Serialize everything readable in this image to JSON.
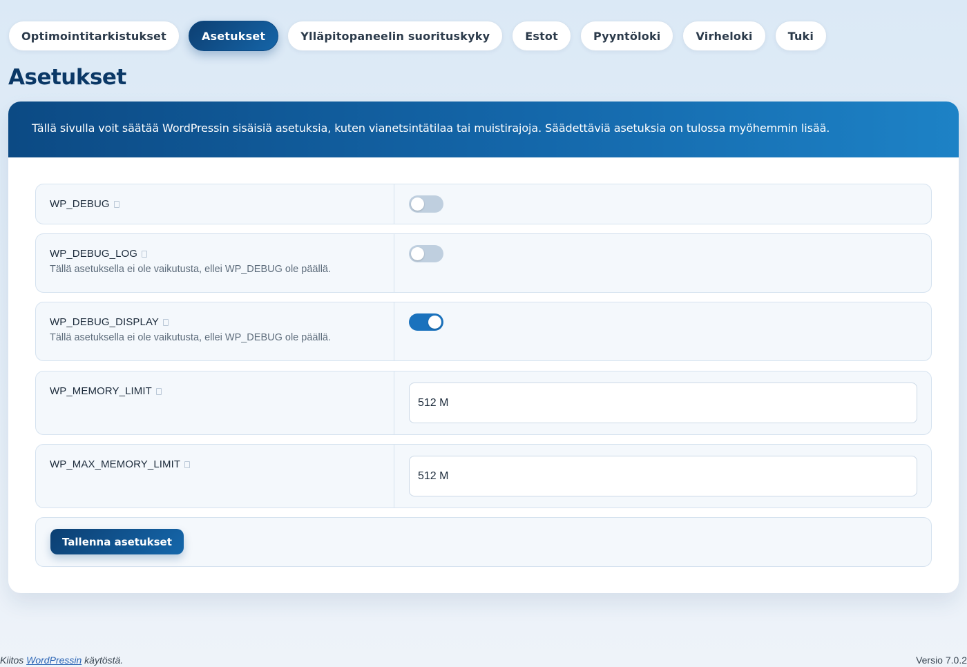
{
  "tabs": [
    {
      "label": "Optimointitarkistukset",
      "active": false
    },
    {
      "label": "Asetukset",
      "active": true
    },
    {
      "label": "Ylläpitopaneelin suorituskyky",
      "active": false
    },
    {
      "label": "Estot",
      "active": false
    },
    {
      "label": "Pyyntöloki",
      "active": false
    },
    {
      "label": "Virheloki",
      "active": false
    },
    {
      "label": "Tuki",
      "active": false
    }
  ],
  "page_title": "Asetukset",
  "card": {
    "header_text": "Tällä sivulla voit säätää WordPressin sisäisiä asetuksia, kuten vianetsintätilaa tai muistirajoja. Säädettäviä asetuksia on tulossa myöhemmin lisää."
  },
  "settings": [
    {
      "name": "WP_DEBUG",
      "description": "",
      "control": "toggle",
      "enabled": false
    },
    {
      "name": "WP_DEBUG_LOG",
      "description": "Tällä asetuksella ei ole vaikutusta, ellei WP_DEBUG ole päällä.",
      "control": "toggle",
      "enabled": false
    },
    {
      "name": "WP_DEBUG_DISPLAY",
      "description": "Tällä asetuksella ei ole vaikutusta, ellei WP_DEBUG ole päällä.",
      "control": "toggle",
      "enabled": true
    },
    {
      "name": "WP_MEMORY_LIMIT",
      "description": "",
      "control": "text",
      "value": "512 M"
    },
    {
      "name": "WP_MAX_MEMORY_LIMIT",
      "description": "",
      "control": "text",
      "value": "512 M"
    }
  ],
  "save_button_label": "Tallenna asetukset",
  "footer": {
    "thanks_prefix": "Kiitos",
    "thanks_link": "WordPressin",
    "thanks_suffix": "käytöstä.",
    "version": "Versio 7.0.2"
  },
  "colors": {
    "accent": "#1467aa",
    "accent_dark": "#0c3f72",
    "toggle_on": "#1a72bd",
    "toggle_off": "#bfcfdf"
  }
}
